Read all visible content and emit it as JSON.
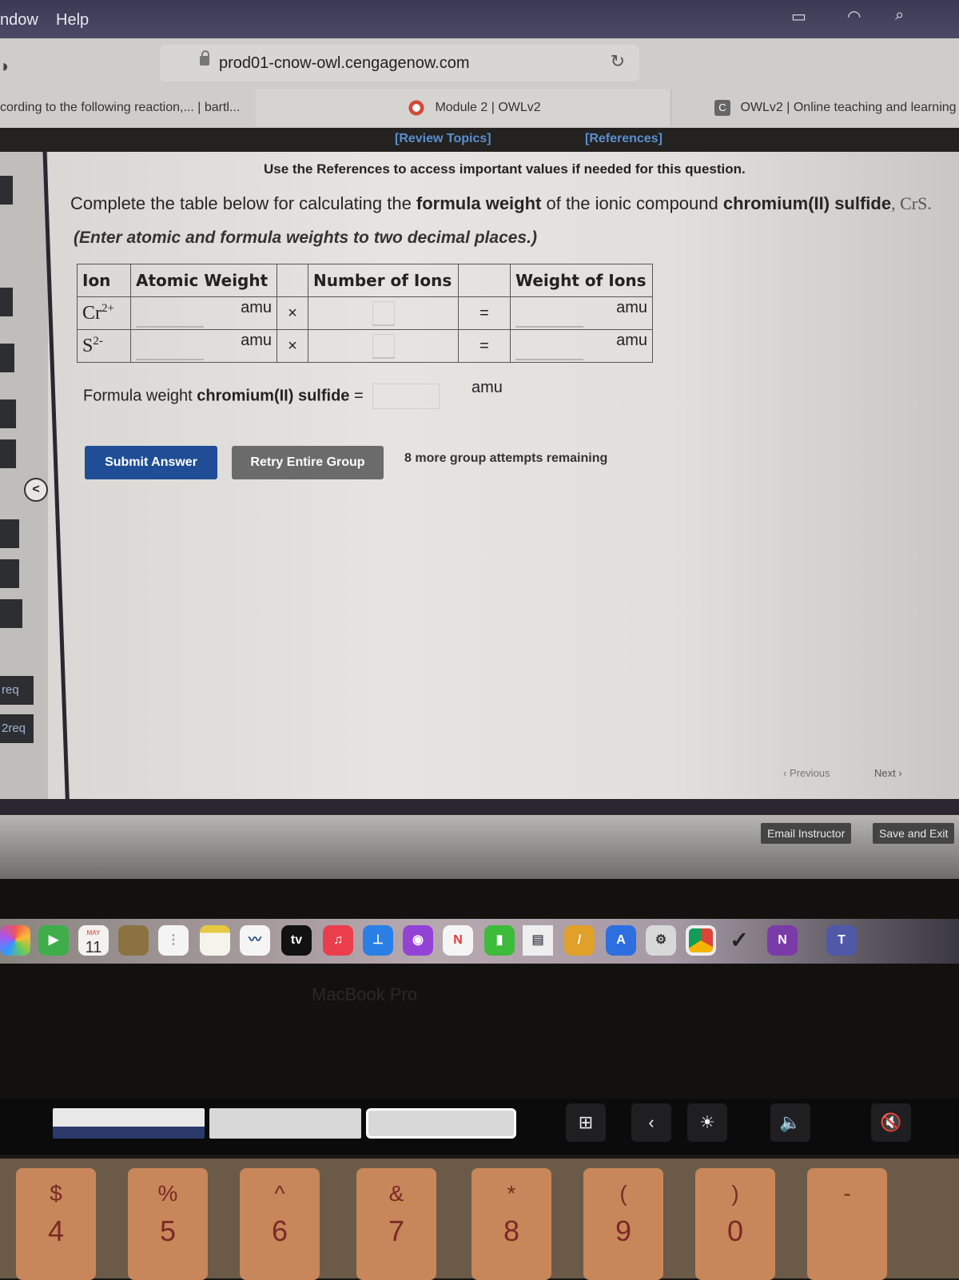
{
  "menubar": {
    "items": [
      "ndow",
      "Help"
    ]
  },
  "browser": {
    "url": "prod01-cnow-owl.cengagenow.com",
    "tabs": [
      {
        "label": "cording to the following reaction,... | bartl..."
      },
      {
        "label": "Module 2 | OWLv2",
        "favicon": "canvas-icon"
      },
      {
        "label": "OWLv2 | Online teaching and learning",
        "favicon_letter": "C"
      }
    ]
  },
  "owl_toolbar": {
    "review_topics": "[Review Topics]",
    "references": "[References]"
  },
  "sidebar": {
    "items": [
      "",
      "",
      "",
      "",
      "",
      "",
      "",
      "req",
      "2req"
    ],
    "collapse_glyph": "<"
  },
  "question": {
    "note": "Use the References to access important values if needed for this question.",
    "text_pre": "Complete the table below for calculating the ",
    "text_bold1": "formula weight",
    "text_mid": " of the ionic compound ",
    "text_bold2": "chromium(II) sulfide",
    "text_formula": ", CrS.",
    "instruction": "(Enter atomic and formula weights to two decimal places.)"
  },
  "table": {
    "headers": {
      "ion": "Ion",
      "atomic_weight": "Atomic Weight",
      "number_of_ions": "Number of Ions",
      "weight_of_ions": "Weight of Ions"
    },
    "rows": [
      {
        "ion": "Cr",
        "charge": "2+",
        "unit1": "amu",
        "times": "×",
        "equals": "=",
        "unit2": "amu",
        "atomic_weight": "",
        "number": "",
        "weight": ""
      },
      {
        "ion": "S",
        "charge": "2-",
        "unit1": "amu",
        "times": "×",
        "equals": "=",
        "unit2": "amu",
        "atomic_weight": "",
        "number": "",
        "weight": ""
      }
    ],
    "formula_label_pre": "Formula weight ",
    "formula_label_bold": "chromium(II) sulfide",
    "formula_label_eq": " =",
    "formula_value": "",
    "formula_unit": "amu"
  },
  "actions": {
    "submit": "Submit Answer",
    "retry": "Retry Entire Group",
    "attempts": "8 more group attempts remaining"
  },
  "pager": {
    "previous": "Previous",
    "next": "Next"
  },
  "footer": {
    "email_instructor": "Email Instructor",
    "save_and_exit": "Save and Exit"
  },
  "dock": {
    "calendar_month": "MAY",
    "calendar_day": "11",
    "apps": [
      "photos",
      "facetime",
      "calendar",
      "contacts",
      "reminders",
      "notes",
      "freeform",
      "tv",
      "music",
      "keynote",
      "podcasts",
      "news",
      "numbers",
      "printer",
      "pages",
      "app-store",
      "system-settings",
      "chrome",
      "check",
      "onenote",
      "teams"
    ],
    "tv_label": "tv",
    "device_label": "MacBook Pro"
  },
  "keyboard": {
    "keys": [
      {
        "sym": "$",
        "num": "4"
      },
      {
        "sym": "%",
        "num": "5"
      },
      {
        "sym": "^",
        "num": "6"
      },
      {
        "sym": "&",
        "num": "7"
      },
      {
        "sym": "*",
        "num": "8"
      },
      {
        "sym": "(",
        "num": "9"
      },
      {
        "sym": ")",
        "num": "0"
      },
      {
        "sym": "-",
        "num": ""
      }
    ]
  },
  "touchbar": {
    "new_tab_glyph": "⊞",
    "back_glyph": "‹",
    "brightness_glyph": "☀",
    "volume_glyph": "🔈",
    "mute_glyph": "🔇"
  }
}
